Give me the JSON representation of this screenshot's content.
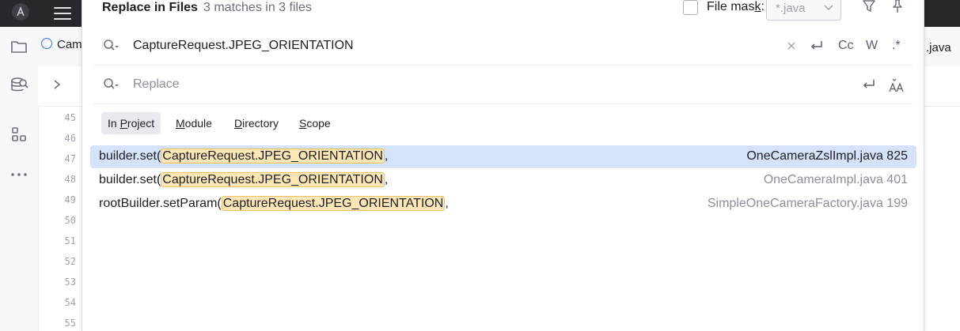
{
  "popup": {
    "title": "Replace in Files",
    "match_summary": "3 matches in 3 files",
    "file_mask_label_prefix": "File mas",
    "file_mask_label_mnemonic": "k",
    "file_mask_label_suffix": ":",
    "file_mask_value": "*.java"
  },
  "search": {
    "value": "CaptureRequest.JPEG_ORIENTATION",
    "opt_case": "Cc",
    "opt_words": "W",
    "opt_regex": ".*"
  },
  "replace": {
    "placeholder": "Replace"
  },
  "scopes": [
    {
      "pre": "In ",
      "key": "P",
      "post": "roject"
    },
    {
      "pre": "",
      "key": "M",
      "post": "odule"
    },
    {
      "pre": "",
      "key": "D",
      "post": "irectory"
    },
    {
      "pre": "",
      "key": "S",
      "post": "cope"
    }
  ],
  "results": [
    {
      "prefix": "builder.set(",
      "match": "CaptureRequest.JPEG_ORIENTATION",
      "suffix": ",",
      "file": "OneCameraZslImpl.java 825"
    },
    {
      "prefix": "builder.set(",
      "match": "CaptureRequest.JPEG_ORIENTATION",
      "suffix": ",",
      "file": "OneCameraImpl.java 401"
    },
    {
      "prefix": "rootBuilder.setParam(",
      "match": "CaptureRequest.JPEG_ORIENTATION",
      "suffix": ",",
      "file": "SimpleOneCameraFactory.java 199"
    }
  ],
  "editor": {
    "tab_left": "Cam",
    "tab_right": ".java",
    "line_numbers": [
      "45",
      "46",
      "47",
      "48",
      "49",
      "50",
      "51",
      "52",
      "53",
      "54",
      "55"
    ]
  },
  "colors": {
    "accent": "#3574f0",
    "selection": "#d5e2fb",
    "match_highlight": "#fce6b6"
  }
}
